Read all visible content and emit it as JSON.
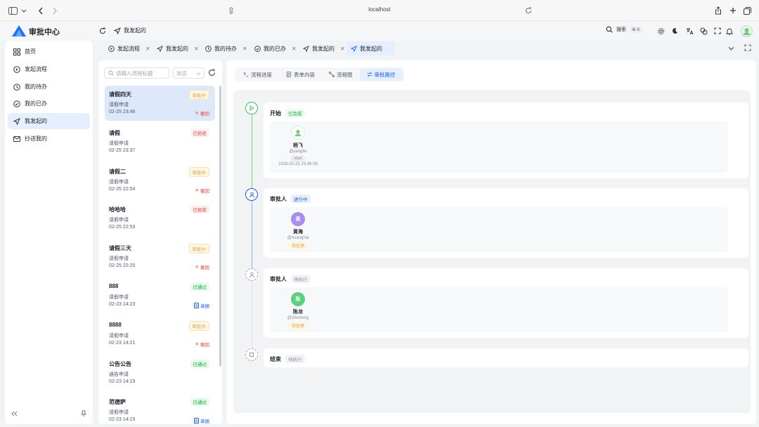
{
  "browser": {
    "url": "localhost"
  },
  "header": {
    "app_title": "审批中心",
    "breadcrumb": "我发起的",
    "search_label": "搜索",
    "search_shortcut": "⌘ K"
  },
  "sidebar": {
    "items": [
      {
        "label": "首页",
        "icon": "dashboard-icon"
      },
      {
        "label": "发起流程",
        "icon": "play-circle-icon"
      },
      {
        "label": "我的待办",
        "icon": "clock-icon"
      },
      {
        "label": "我的已办",
        "icon": "check-circle-icon"
      },
      {
        "label": "我发起的",
        "icon": "send-icon",
        "active": true
      },
      {
        "label": "抄送我的",
        "icon": "mail-icon"
      }
    ]
  },
  "tabs": [
    {
      "label": "发起流程",
      "icon": "play-circle-icon"
    },
    {
      "label": "我发起的",
      "icon": "send-icon"
    },
    {
      "label": "我的待办",
      "icon": "clock-icon"
    },
    {
      "label": "我的已办",
      "icon": "check-circle-icon"
    },
    {
      "label": "我发起的",
      "icon": "send-icon"
    },
    {
      "label": "我发起的",
      "icon": "send-icon",
      "active": true
    }
  ],
  "list": {
    "search_placeholder": "请输入流程标题",
    "status_placeholder": "状态",
    "items": [
      {
        "title": "请假四天",
        "sub": "请假申请",
        "time": "02-25 23:46",
        "status": "审批中",
        "status_type": "warn",
        "action": "撤回",
        "action_type": "revoke",
        "selected": true
      },
      {
        "title": "请假",
        "sub": "请假申请",
        "time": "02-25 23:37",
        "status": "已拒绝",
        "status_type": "reject",
        "action": "",
        "action_type": ""
      },
      {
        "title": "请假二",
        "sub": "请假申请",
        "time": "02-25 22:54",
        "status": "审批中",
        "status_type": "warn",
        "action": "撤回",
        "action_type": "revoke"
      },
      {
        "title": "哈哈哈",
        "sub": "请假申请",
        "time": "02-25 22:53",
        "status": "已拒绝",
        "status_type": "reject",
        "action": "",
        "action_type": ""
      },
      {
        "title": "请假三天",
        "sub": "请假申请",
        "time": "02-25 22:20",
        "status": "审批中",
        "status_type": "warn",
        "action": "撤回",
        "action_type": "revoke"
      },
      {
        "title": "888",
        "sub": "请假申请",
        "time": "02-23 14:23",
        "status": "已通过",
        "status_type": "ok",
        "action": "单据",
        "action_type": "doc"
      },
      {
        "title": "8888",
        "sub": "请假申请",
        "time": "02-23 14:21",
        "status": "审批中",
        "status_type": "warn",
        "action": "撤回",
        "action_type": "revoke"
      },
      {
        "title": "公告公告",
        "sub": "通告申请",
        "time": "02-23 14:19",
        "status": "已通过",
        "status_type": "ok",
        "action": "",
        "action_type": ""
      },
      {
        "title": "范德萨",
        "sub": "请假申请",
        "time": "02-23 14:15",
        "status": "已通过",
        "status_type": "ok",
        "action": "单据",
        "action_type": "doc"
      }
    ]
  },
  "detail": {
    "tabs": [
      {
        "label": "流程进度",
        "icon": "progress-icon"
      },
      {
        "label": "表单内容",
        "icon": "form-icon"
      },
      {
        "label": "流程图",
        "icon": "flowchart-icon"
      },
      {
        "label": "审批路径",
        "icon": "path-icon",
        "active": true
      }
    ],
    "nodes": [
      {
        "title": "开始",
        "status": "已完成",
        "status_type": "done",
        "icon": "play-icon",
        "user": {
          "name": "杨飞",
          "id": "@yangfei",
          "tag": "start",
          "time": "2026-02-25 23:46:36",
          "avatar": "",
          "avatar_color": "#ffffff"
        }
      },
      {
        "title": "审批人",
        "status": "进行中",
        "status_type": "run",
        "icon": "user-icon",
        "user": {
          "name": "黄海",
          "id": "@huanghai",
          "tag": "待处理",
          "time": "",
          "avatar": "黄",
          "avatar_color": "#a98cf5"
        }
      },
      {
        "title": "审批人",
        "status": "待执行",
        "status_type": "wait",
        "icon": "user-dashed-icon",
        "user": {
          "name": "陈龙",
          "id": "@chenlong",
          "tag": "待处理",
          "time": "",
          "avatar": "陈",
          "avatar_color": "#5ad17a"
        }
      },
      {
        "title": "结束",
        "status": "待执行",
        "status_type": "wait",
        "icon": "stop-icon",
        "user": null
      }
    ]
  },
  "colors": {
    "primary": "#165dff",
    "success": "#00b42a",
    "warning": "#e6a23c",
    "danger": "#f53f3f"
  }
}
